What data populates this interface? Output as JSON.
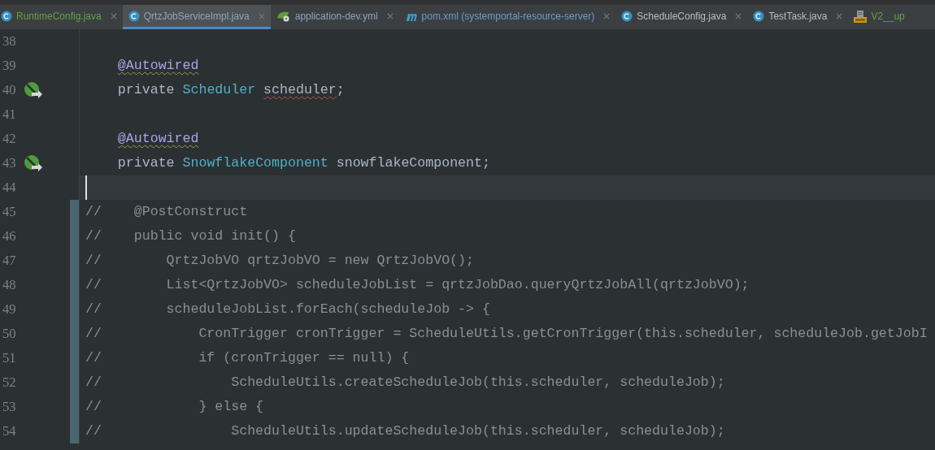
{
  "tabs": [
    {
      "label": "RuntimeConfig.java",
      "kind": "class",
      "color": "#62a144",
      "selected": false,
      "closable": true
    },
    {
      "label": "QrtzJobServiceImpl.java",
      "kind": "class",
      "color": "#8aa4c0",
      "selected": true,
      "closable": true
    },
    {
      "label": "application-dev.yml",
      "kind": "yaml",
      "color": "#8aa4c0",
      "selected": false,
      "closable": true
    },
    {
      "label": "pom.xml (systemportal-resource-server)",
      "kind": "maven",
      "color": "#6a9ccb",
      "selected": false,
      "closable": true
    },
    {
      "label": "ScheduleConfig.java",
      "kind": "class",
      "color": "#bbbbbb",
      "selected": false,
      "closable": true
    },
    {
      "label": "TestTask.java",
      "kind": "class",
      "color": "#bbbbbb",
      "selected": false,
      "closable": true
    },
    {
      "label": "V2__up",
      "kind": "sql",
      "color": "#62a144",
      "selected": false,
      "closable": false
    }
  ],
  "editor": {
    "lines": [
      {
        "number": "38"
      },
      {
        "number": "39",
        "segments": [
          {
            "text": "    @Autowired",
            "kind": "annotation"
          }
        ]
      },
      {
        "number": "40",
        "gutter_icon": true,
        "segments": [
          {
            "text": "    private ",
            "kind": "keyword"
          },
          {
            "text": "Scheduler",
            "kind": "type"
          },
          {
            "text": " scheduler",
            "kind": "typo"
          },
          {
            "text": ";",
            "kind": "plain"
          }
        ]
      },
      {
        "number": "41"
      },
      {
        "number": "42",
        "segments": [
          {
            "text": "    @Autowired",
            "kind": "annotation"
          }
        ]
      },
      {
        "number": "43",
        "gutter_icon": true,
        "segments": [
          {
            "text": "    private ",
            "kind": "keyword"
          },
          {
            "text": "SnowflakeComponent",
            "kind": "type"
          },
          {
            "text": " snowflakeComponent;",
            "kind": "plain"
          }
        ]
      },
      {
        "number": "44",
        "current": true
      },
      {
        "number": "45",
        "block_marker": true,
        "segments": [
          {
            "text": "//    @PostConstruct",
            "kind": "comment"
          }
        ]
      },
      {
        "number": "46",
        "block_marker": true,
        "segments": [
          {
            "text": "//    public void init() {",
            "kind": "comment"
          }
        ]
      },
      {
        "number": "47",
        "block_marker": true,
        "segments": [
          {
            "text": "//        QrtzJobVO qrtzJobVO = new QrtzJobVO();",
            "kind": "comment"
          }
        ]
      },
      {
        "number": "48",
        "block_marker": true,
        "segments": [
          {
            "text": "//        List<QrtzJobVO> scheduleJobList = qrtzJobDao.queryQrtzJobAll(qrtzJobVO);",
            "kind": "comment"
          }
        ]
      },
      {
        "number": "49",
        "block_marker": true,
        "segments": [
          {
            "text": "//        scheduleJobList.forEach(scheduleJob -> {",
            "kind": "comment"
          }
        ]
      },
      {
        "number": "50",
        "block_marker": true,
        "segments": [
          {
            "text": "//            CronTrigger cronTrigger = ScheduleUtils.getCronTrigger(this.scheduler, scheduleJob.getJobI",
            "kind": "comment"
          }
        ]
      },
      {
        "number": "51",
        "block_marker": true,
        "segments": [
          {
            "text": "//            if (cronTrigger == null) {",
            "kind": "comment"
          }
        ]
      },
      {
        "number": "52",
        "block_marker": true,
        "segments": [
          {
            "text": "//                ScheduleUtils.createScheduleJob(this.scheduler, scheduleJob);",
            "kind": "comment"
          }
        ]
      },
      {
        "number": "53",
        "block_marker": true,
        "segments": [
          {
            "text": "//            } else {",
            "kind": "comment"
          }
        ]
      },
      {
        "number": "54",
        "block_marker": true,
        "segments": [
          {
            "text": "//                ScheduleUtils.updateScheduleJob(this.scheduler, scheduleJob);",
            "kind": "comment"
          }
        ]
      }
    ]
  }
}
